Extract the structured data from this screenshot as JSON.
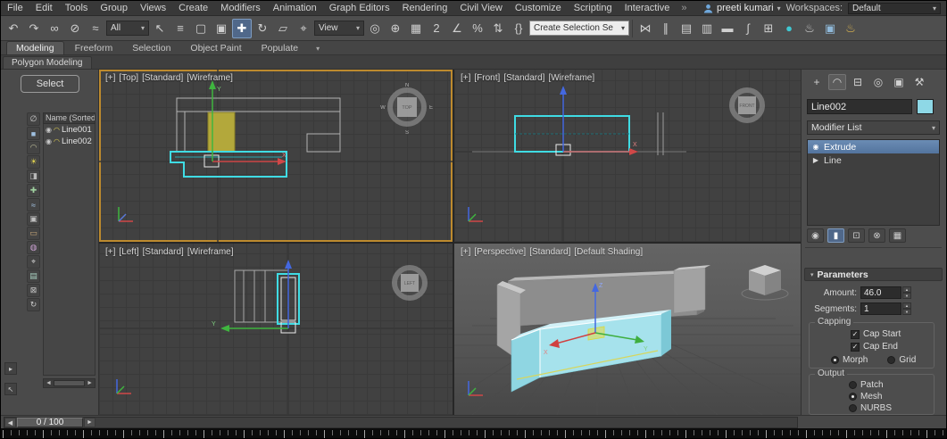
{
  "icons": {
    "caret": "▾",
    "eye": "◉"
  },
  "axis_labels": {
    "x": "X",
    "y": "Y",
    "z": "Z"
  },
  "compass": {
    "n": "N",
    "s": "S",
    "e": "E",
    "w": "W"
  },
  "menubar": {
    "items": [
      "File",
      "Edit",
      "Tools",
      "Group",
      "Views",
      "Create",
      "Modifiers",
      "Animation",
      "Graph Editors",
      "Rendering",
      "Civil View",
      "Customize",
      "Scripting",
      "Interactive"
    ],
    "overflow": "»",
    "user": {
      "name": "preeti kumari"
    },
    "workspaces_label": "Workspaces:",
    "workspace_value": "Default"
  },
  "toolbar": {
    "group1": [
      {
        "name": "undo-icon",
        "glyph": "↶"
      },
      {
        "name": "redo-icon",
        "glyph": "↷"
      },
      {
        "name": "select-and-link-icon",
        "glyph": "∞"
      },
      {
        "name": "unlink-selection-icon",
        "glyph": "⊘"
      },
      {
        "name": "bind-to-space-warp-icon",
        "glyph": "≈"
      }
    ],
    "filter": {
      "value": "All"
    },
    "group2": [
      {
        "name": "select-object-icon",
        "glyph": "↖"
      },
      {
        "name": "select-by-name-icon",
        "glyph": "≡"
      },
      {
        "name": "rectangular-selection-region-icon",
        "glyph": "▢"
      },
      {
        "name": "window-crossing-toggle-icon",
        "glyph": "▣"
      },
      {
        "name": "select-and-move-icon",
        "glyph": "✚",
        "active": true
      },
      {
        "name": "select-and-rotate-icon",
        "glyph": "↻"
      },
      {
        "name": "select-and-scale-icon",
        "glyph": "▱"
      },
      {
        "name": "select-and-place-icon",
        "glyph": "⌖"
      }
    ],
    "coord_system": {
      "value": "View"
    },
    "group3": [
      {
        "name": "use-pivot-point-center-icon",
        "glyph": "◎"
      },
      {
        "name": "select-and-manipulate-icon",
        "glyph": "⊕"
      },
      {
        "name": "keyboard-shortcut-override-icon",
        "glyph": "▦"
      },
      {
        "name": "snaps-toggle-icon",
        "glyph": "2"
      },
      {
        "name": "angle-snap-icon",
        "glyph": "∠"
      },
      {
        "name": "percent-snap-icon",
        "glyph": "%"
      },
      {
        "name": "spinner-snap-icon",
        "glyph": "⇅"
      },
      {
        "name": "named-selection-sets-icon",
        "glyph": "{}"
      }
    ],
    "selection_set": {
      "value": "Create Selection Se"
    },
    "group4": [
      {
        "name": "mirror-icon",
        "glyph": "⋈"
      },
      {
        "name": "align-icon",
        "glyph": "∥"
      },
      {
        "name": "toggle-scene-explorer-icon",
        "glyph": "▤"
      },
      {
        "name": "toggle-layer-explorer-icon",
        "glyph": "▥"
      },
      {
        "name": "toggle-ribbon-icon",
        "glyph": "▬"
      },
      {
        "name": "curve-editor-icon",
        "glyph": "∫"
      },
      {
        "name": "schematic-view-icon",
        "glyph": "⊞"
      },
      {
        "name": "material-editor-icon",
        "glyph": "●",
        "color": "#3fc8d2"
      },
      {
        "name": "render-setup-icon",
        "glyph": "♨",
        "color": "#cfcfcf"
      },
      {
        "name": "rendered-frame-window-icon",
        "glyph": "▣",
        "color": "#8fb8d8"
      },
      {
        "name": "render-production-icon",
        "glyph": "♨",
        "color": "#e0b84f"
      }
    ]
  },
  "ribbon": {
    "tabs": [
      {
        "name": "ribbon-tab-modeling",
        "label": "Modeling",
        "active": true
      },
      {
        "name": "ribbon-tab-freeform",
        "label": "Freeform"
      },
      {
        "name": "ribbon-tab-selection",
        "label": "Selection"
      },
      {
        "name": "ribbon-tab-object-paint",
        "label": "Object Paint"
      },
      {
        "name": "ribbon-tab-populate",
        "label": "Populate"
      }
    ],
    "minimize": "▾",
    "subtab": "Polygon Modeling"
  },
  "scene_explorer": {
    "select_label": "Select",
    "name_header": "Name (Sorted A",
    "items": [
      {
        "name": "scene-item-line001",
        "label": "Line001"
      },
      {
        "name": "scene-item-line002",
        "label": "Line002"
      }
    ],
    "tools": [
      {
        "name": "display-none-icon",
        "glyph": "∅",
        "color": "#c8c8c8"
      },
      {
        "name": "display-objects-icon",
        "glyph": "■",
        "color": "#9fc0e0"
      },
      {
        "name": "display-shapes-icon",
        "glyph": "◠",
        "color": "#c8c8a0"
      },
      {
        "name": "display-lights-icon",
        "glyph": "☀",
        "color": "#e0d24f"
      },
      {
        "name": "display-cameras-icon",
        "glyph": "◨",
        "color": "#b8b8b8"
      },
      {
        "name": "display-helpers-icon",
        "glyph": "✚",
        "color": "#9fd09f"
      },
      {
        "name": "display-spacewarps-icon",
        "glyph": "≈",
        "color": "#a8c8e8"
      },
      {
        "name": "display-groups-icon",
        "glyph": "▣",
        "color": "#c0c0c0"
      },
      {
        "name": "display-xrefs-icon",
        "glyph": "▭",
        "color": "#c8a878"
      },
      {
        "name": "display-materials-icon",
        "glyph": "◍",
        "color": "#c89fd0"
      },
      {
        "name": "display-bones-icon",
        "glyph": "⌖",
        "color": "#c8c8c8"
      },
      {
        "name": "display-containers-icon",
        "glyph": "▤",
        "color": "#a8d0c0"
      },
      {
        "name": "lock-cell-editing-icon",
        "glyph": "⊠",
        "color": "#c8c8c8"
      },
      {
        "name": "sync-selection-icon",
        "glyph": "↻",
        "color": "#c8c8c8"
      }
    ],
    "scroll_left": "◄",
    "scroll_right": "►",
    "dock_arrow": "▸",
    "dock_cursor": "↖"
  },
  "viewports": {
    "top": {
      "plus": "[+]",
      "view": "[Top]",
      "style": "[Standard]",
      "shading": "[Wireframe]",
      "cube": "TOP"
    },
    "front": {
      "plus": "[+]",
      "view": "[Front]",
      "style": "[Standard]",
      "shading": "[Wireframe]",
      "cube": "FRONT"
    },
    "left": {
      "plus": "[+]",
      "view": "[Left]",
      "style": "[Standard]",
      "shading": "[Wireframe]",
      "cube": "LEFT"
    },
    "persp": {
      "plus": "[+]",
      "view": "[Perspective]",
      "style": "[Standard]",
      "shading": "[Default Shading]"
    }
  },
  "command_panel": {
    "tabs": [
      {
        "name": "create-tab-icon",
        "glyph": "+"
      },
      {
        "name": "modify-tab-icon",
        "glyph": "◠",
        "active": true
      },
      {
        "name": "hierarchy-tab-icon",
        "glyph": "⊟"
      },
      {
        "name": "motion-tab-icon",
        "glyph": "◎"
      },
      {
        "name": "display-tab-icon",
        "glyph": "▣"
      },
      {
        "name": "utilities-tab-icon",
        "glyph": "⚒"
      }
    ],
    "object_name": "Line002",
    "object_color": "#8ed8e6",
    "modifier_list_label": "Modifier List",
    "stack": [
      {
        "name": "stack-item-extrude",
        "icon": "◉",
        "label": "Extrude",
        "selected": true
      },
      {
        "name": "stack-item-line",
        "icon": "▶",
        "label": "Line"
      }
    ],
    "stack_tools": [
      {
        "name": "pin-stack-icon",
        "glyph": "◉"
      },
      {
        "name": "show-end-result-icon",
        "glyph": "▮",
        "active": true
      },
      {
        "name": "make-unique-icon",
        "glyph": "⊡"
      },
      {
        "name": "remove-modifier-icon",
        "glyph": "⊗"
      },
      {
        "name": "configure-modifier-sets-icon",
        "glyph": "▦"
      }
    ],
    "parameters": {
      "title": "Parameters",
      "amount_label": "Amount:",
      "amount_value": "46.0",
      "segments_label": "Segments:",
      "segments_value": "1",
      "capping_title": "Capping",
      "cap_start_label": "Cap Start",
      "cap_start_checked": true,
      "cap_end_label": "Cap End",
      "cap_end_checked": true,
      "morph_label": "Morph",
      "morph_on": true,
      "grid_label": "Grid",
      "grid_on": false,
      "output_title": "Output",
      "patch_label": "Patch",
      "patch_on": false,
      "mesh_label": "Mesh",
      "mesh_on": true,
      "nurbs_label": "NURBS",
      "nurbs_on": false
    }
  },
  "timeline": {
    "prev": "◀",
    "next": "►",
    "frame_display": "0 / 100"
  }
}
